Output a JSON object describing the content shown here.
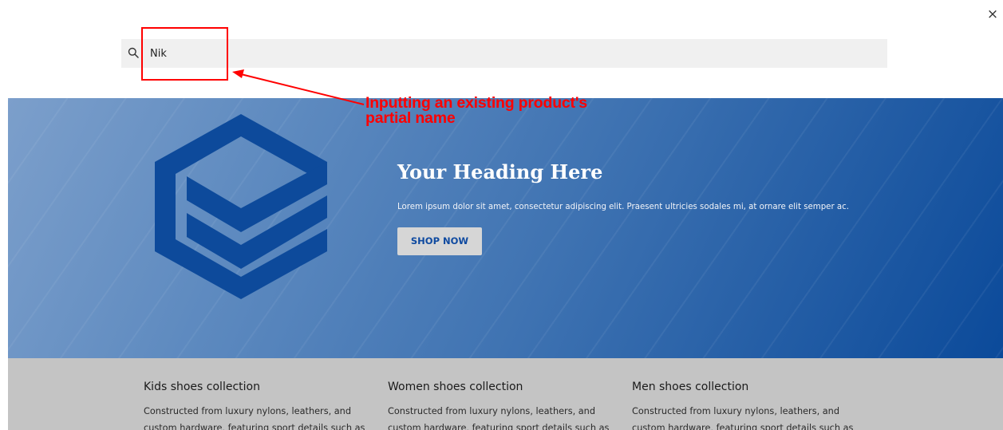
{
  "window": {
    "close_glyph": "×"
  },
  "search": {
    "value": "Nik",
    "placeholder": "",
    "icon": "search-icon"
  },
  "annotation": {
    "text": "Inputting an existing product's partial name",
    "color": "#ff0000"
  },
  "hero": {
    "heading": "Your Heading Here",
    "text": "Lorem ipsum dolor sit amet, consectetur adipiscing elit. Praesent ultricies sodales mi, at ornare elit semper ac.",
    "button_label": "SHOP NOW",
    "logo": "hexagon-layers-logo",
    "colors": {
      "start": "#7c9fcb",
      "end": "#0b4a9a",
      "logo": "#0d4a9b",
      "button_text": "#0f4aa0"
    }
  },
  "collections": [
    {
      "title": "Kids shoes collection",
      "description": "Constructed from luxury nylons, leathers, and custom hardware, featuring sport details such as"
    },
    {
      "title": "Women shoes collection",
      "description": "Constructed from luxury nylons, leathers, and custom hardware, featuring sport details such as"
    },
    {
      "title": "Men shoes collection",
      "description": "Constructed from luxury nylons, leathers, and custom hardware, featuring sport details such as"
    }
  ]
}
